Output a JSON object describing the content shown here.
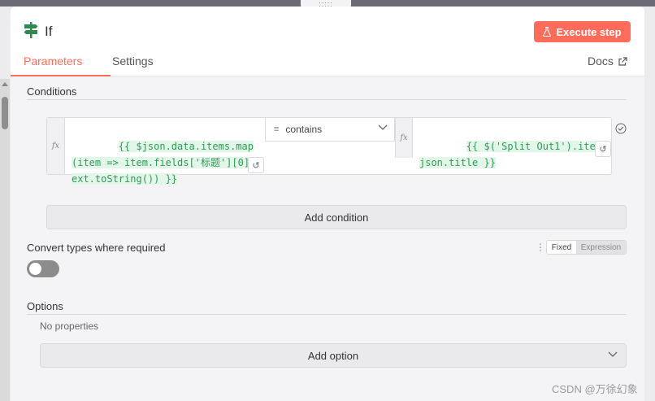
{
  "header": {
    "title": "If",
    "execute_label": "Execute step"
  },
  "tabs": {
    "parameters": "Parameters",
    "settings": "Settings",
    "docs": "Docs"
  },
  "conditions": {
    "title": "Conditions",
    "fx_label": "fx",
    "left_value": "{{ $json.data.items.map(item => item.fields['标题'][0].text.toString()) }}",
    "operator": "contains",
    "right_value": "{{ $('Split Out1').item.json.title }}",
    "add_label": "Add condition"
  },
  "convert": {
    "label": "Convert types where required",
    "mode_fixed": "Fixed",
    "mode_expression": "Expression",
    "enabled": false
  },
  "options": {
    "title": "Options",
    "empty_text": "No properties",
    "add_label": "Add option"
  },
  "watermark": "CSDN @万徐幻象",
  "colors": {
    "accent": "#ff6d5a",
    "expression_text": "#2f9a55",
    "node_icon": "#2f8a4e"
  }
}
